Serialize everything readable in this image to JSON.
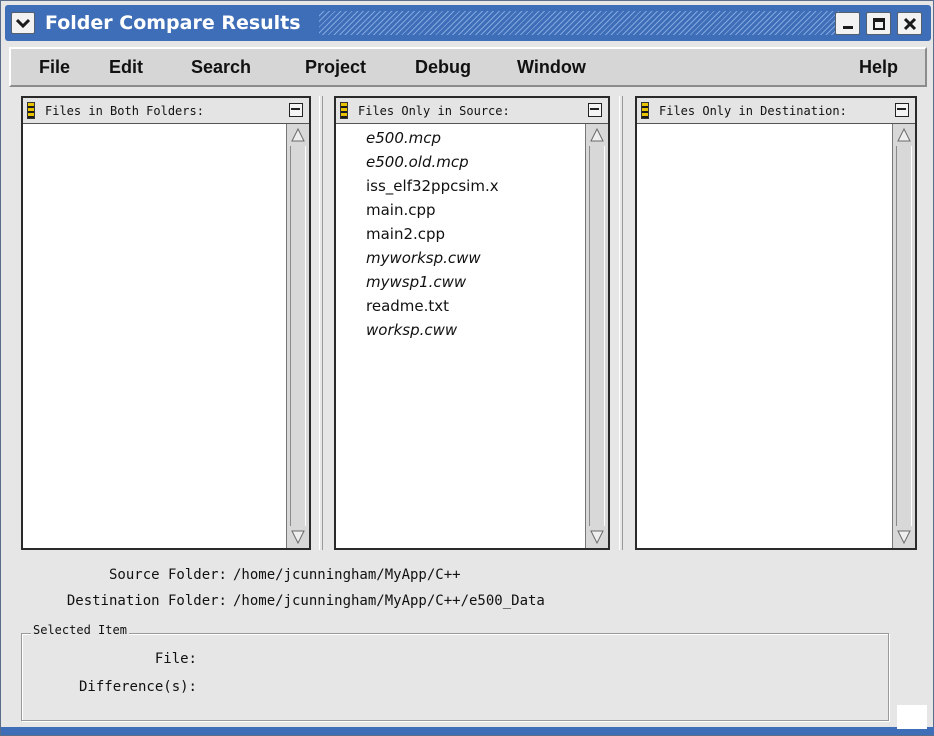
{
  "window": {
    "title": "Folder Compare Results",
    "accent_color": "#3f6eb8",
    "controls": {
      "menu_icon": "chevron-down-icon",
      "minimize_icon": "minimize-icon",
      "maximize_icon": "maximize-icon",
      "close_icon": "close-icon"
    }
  },
  "menubar": {
    "items": [
      {
        "label": "File"
      },
      {
        "label": "Edit"
      },
      {
        "label": "Search"
      },
      {
        "label": "Project"
      },
      {
        "label": "Debug"
      },
      {
        "label": "Window"
      },
      {
        "label": "Help"
      }
    ]
  },
  "panels": [
    {
      "header": "Files in Both Folders:",
      "items": []
    },
    {
      "header": "Files Only in Source:",
      "items": [
        {
          "name": "e500.mcp",
          "italic": true
        },
        {
          "name": "e500.old.mcp",
          "italic": true
        },
        {
          "name": "iss_elf32ppcsim.x",
          "italic": false
        },
        {
          "name": "main.cpp",
          "italic": false
        },
        {
          "name": "main2.cpp",
          "italic": false
        },
        {
          "name": "myworksp.cww",
          "italic": true
        },
        {
          "name": "mywsp1.cww",
          "italic": true
        },
        {
          "name": "readme.txt",
          "italic": false
        },
        {
          "name": "worksp.cww",
          "italic": true
        }
      ]
    },
    {
      "header": "Files Only in Destination:",
      "items": []
    }
  ],
  "folders": {
    "source_label": "Source Folder:",
    "source_value": "/home/jcunningham/MyApp/C++",
    "destination_label": "Destination Folder:",
    "destination_value": "/home/jcunningham/MyApp/C++/e500_Data"
  },
  "selected_item": {
    "legend": "Selected Item",
    "file_label": "File:",
    "file_value": "",
    "difference_label": "Difference(s):",
    "difference_value": ""
  }
}
